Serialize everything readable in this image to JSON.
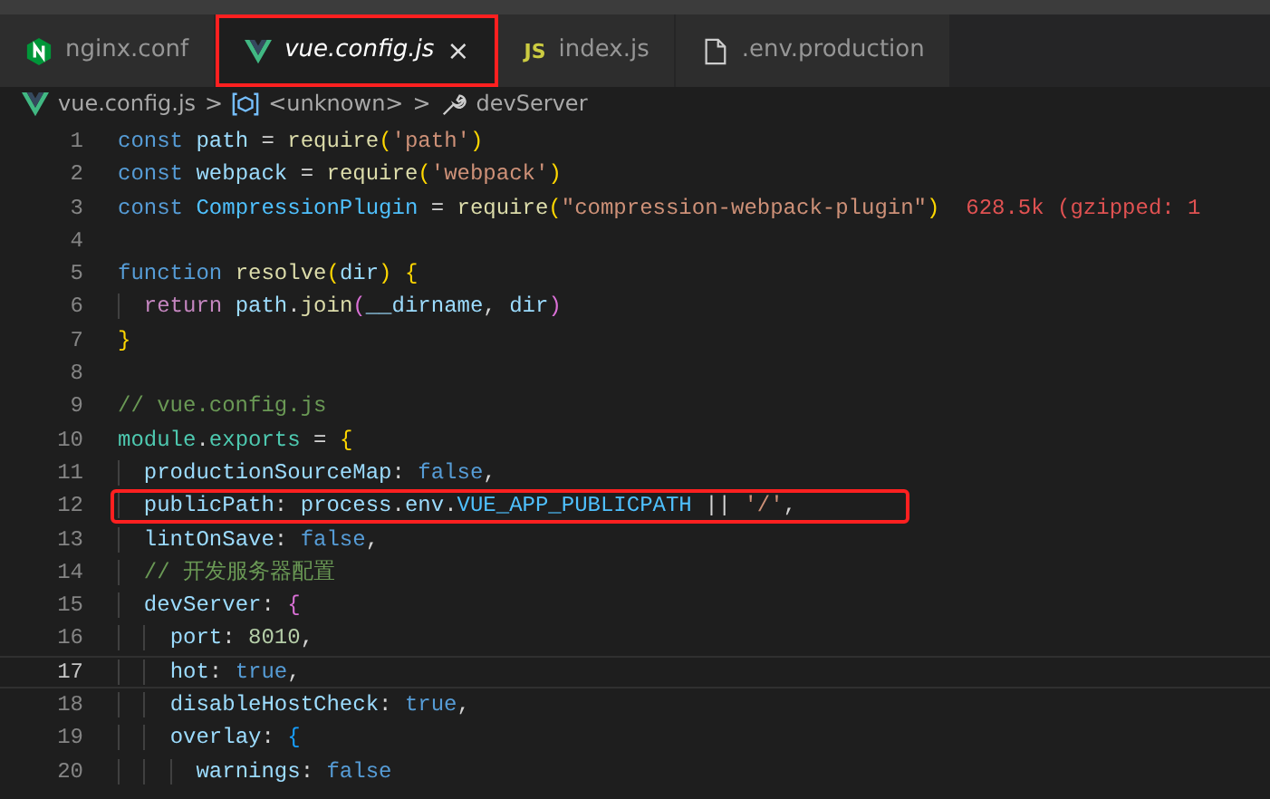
{
  "tabs": [
    {
      "label": "nginx.conf",
      "kind": "nginx",
      "selected": false,
      "italic": false,
      "closable": false,
      "highlighted": false
    },
    {
      "label": "vue.config.js",
      "kind": "vue",
      "selected": true,
      "italic": true,
      "closable": true,
      "highlighted": true
    },
    {
      "label": "index.js",
      "kind": "js",
      "icon_text": "JS",
      "selected": false,
      "italic": false,
      "closable": false,
      "highlighted": false
    },
    {
      "label": ".env.production",
      "kind": "file",
      "selected": false,
      "italic": false,
      "closable": false,
      "highlighted": false
    }
  ],
  "close_glyph": "×",
  "breadcrumb": [
    {
      "kind": "vue",
      "label": "vue.config.js"
    },
    {
      "kind": "module",
      "label": "<unknown>"
    },
    {
      "kind": "wrench",
      "label": "devServer"
    }
  ],
  "breadcrumb_separator": ">",
  "lines": [
    {
      "number": "1",
      "current": false,
      "highlighted": false,
      "tokens": [
        {
          "t": "const ",
          "kind": "kw"
        },
        {
          "t": "path",
          "kind": "var"
        },
        {
          "t": " = ",
          "kind": "punc"
        },
        {
          "t": "require",
          "kind": "fn"
        },
        {
          "t": "(",
          "kind": "b1"
        },
        {
          "t": "'path'",
          "kind": "str"
        },
        {
          "t": ")",
          "kind": "b1"
        }
      ]
    },
    {
      "number": "2",
      "current": false,
      "highlighted": false,
      "tokens": [
        {
          "t": "const ",
          "kind": "kw"
        },
        {
          "t": "webpack",
          "kind": "var"
        },
        {
          "t": " = ",
          "kind": "punc"
        },
        {
          "t": "require",
          "kind": "fn"
        },
        {
          "t": "(",
          "kind": "b1"
        },
        {
          "t": "'webpack'",
          "kind": "str"
        },
        {
          "t": ")",
          "kind": "b1"
        }
      ]
    },
    {
      "number": "3",
      "current": false,
      "highlighted": false,
      "tokens": [
        {
          "t": "const ",
          "kind": "kw"
        },
        {
          "t": "CompressionPlugin",
          "kind": "const"
        },
        {
          "t": " = ",
          "kind": "punc"
        },
        {
          "t": "require",
          "kind": "fn"
        },
        {
          "t": "(",
          "kind": "b1"
        },
        {
          "t": "\"compression-webpack-plugin\"",
          "kind": "str"
        },
        {
          "t": ")",
          "kind": "b1"
        },
        {
          "t": "  628.5k (gzipped: 1",
          "kind": "hint"
        }
      ]
    },
    {
      "number": "4",
      "current": false
    },
    {
      "number": "5",
      "current": false,
      "highlighted": false,
      "tokens": [
        {
          "t": "function ",
          "kind": "kw"
        },
        {
          "t": "resolve",
          "kind": "fn"
        },
        {
          "t": "(",
          "kind": "b1"
        },
        {
          "t": "dir",
          "kind": "var"
        },
        {
          "t": ")",
          "kind": "b1"
        },
        {
          "t": " {",
          "kind": "b1"
        }
      ]
    },
    {
      "number": "6",
      "current": false,
      "highlighted": false,
      "tokens": [
        {
          "t": "  return ",
          "kind": "ctrl"
        },
        {
          "t": "path",
          "kind": "var"
        },
        {
          "t": ".",
          "kind": "punc"
        },
        {
          "t": "join",
          "kind": "fn"
        },
        {
          "t": "(",
          "kind": "b2"
        },
        {
          "t": "__dirname",
          "kind": "var"
        },
        {
          "t": ", ",
          "kind": "punc"
        },
        {
          "t": "dir",
          "kind": "var"
        },
        {
          "t": ")",
          "kind": "b2"
        }
      ]
    },
    {
      "number": "7",
      "current": false,
      "highlighted": false,
      "tokens": [
        {
          "t": "}",
          "kind": "b1"
        }
      ]
    },
    {
      "number": "8",
      "current": false
    },
    {
      "number": "9",
      "current": false,
      "highlighted": false,
      "tokens": [
        {
          "t": "// vue.config.js",
          "kind": "comment"
        }
      ]
    },
    {
      "number": "10",
      "current": false,
      "highlighted": false,
      "tokens": [
        {
          "t": "module",
          "kind": "type"
        },
        {
          "t": ".",
          "kind": "punc"
        },
        {
          "t": "exports",
          "kind": "type"
        },
        {
          "t": " = ",
          "kind": "punc"
        },
        {
          "t": "{",
          "kind": "b1"
        }
      ]
    },
    {
      "number": "11",
      "current": false,
      "highlighted": false,
      "tokens": [
        {
          "t": "  productionSourceMap",
          "kind": "var"
        },
        {
          "t": ": ",
          "kind": "punc"
        },
        {
          "t": "false",
          "kind": "kw"
        },
        {
          "t": ",",
          "kind": "punc"
        }
      ]
    },
    {
      "number": "12",
      "current": false,
      "highlighted": true,
      "tokens": [
        {
          "t": "  publicPath",
          "kind": "var"
        },
        {
          "t": ": ",
          "kind": "punc"
        },
        {
          "t": "process",
          "kind": "var"
        },
        {
          "t": ".",
          "kind": "punc"
        },
        {
          "t": "env",
          "kind": "var"
        },
        {
          "t": ".",
          "kind": "punc"
        },
        {
          "t": "VUE_APP_PUBLICPATH",
          "kind": "const"
        },
        {
          "t": " || ",
          "kind": "punc"
        },
        {
          "t": "'/'",
          "kind": "str"
        },
        {
          "t": ",",
          "kind": "punc"
        }
      ]
    },
    {
      "number": "13",
      "current": false,
      "highlighted": false,
      "tokens": [
        {
          "t": "  lintOnSave",
          "kind": "var"
        },
        {
          "t": ": ",
          "kind": "punc"
        },
        {
          "t": "false",
          "kind": "kw"
        },
        {
          "t": ",",
          "kind": "punc"
        }
      ]
    },
    {
      "number": "14",
      "current": false,
      "highlighted": false,
      "tokens": [
        {
          "t": "  // 开发服务器配置",
          "kind": "comment"
        }
      ]
    },
    {
      "number": "15",
      "current": false,
      "highlighted": false,
      "tokens": [
        {
          "t": "  devServer",
          "kind": "var"
        },
        {
          "t": ": ",
          "kind": "punc"
        },
        {
          "t": "{",
          "kind": "b2"
        }
      ]
    },
    {
      "number": "16",
      "current": false,
      "highlighted": false,
      "tokens": [
        {
          "t": "    port",
          "kind": "var"
        },
        {
          "t": ": ",
          "kind": "punc"
        },
        {
          "t": "8010",
          "kind": "num"
        },
        {
          "t": ",",
          "kind": "punc"
        }
      ]
    },
    {
      "number": "17",
      "current": true,
      "highlighted": false,
      "tokens": [
        {
          "t": "    hot",
          "kind": "var"
        },
        {
          "t": ": ",
          "kind": "punc"
        },
        {
          "t": "true",
          "kind": "kw"
        },
        {
          "t": ",",
          "kind": "punc"
        }
      ]
    },
    {
      "number": "18",
      "current": false,
      "highlighted": false,
      "tokens": [
        {
          "t": "    disableHostCheck",
          "kind": "var"
        },
        {
          "t": ": ",
          "kind": "punc"
        },
        {
          "t": "true",
          "kind": "kw"
        },
        {
          "t": ",",
          "kind": "punc"
        }
      ]
    },
    {
      "number": "19",
      "current": false,
      "highlighted": false,
      "tokens": [
        {
          "t": "    overlay",
          "kind": "var"
        },
        {
          "t": ": ",
          "kind": "punc"
        },
        {
          "t": "{",
          "kind": "b3"
        }
      ]
    },
    {
      "number": "20",
      "current": false,
      "highlighted": false,
      "tokens": [
        {
          "t": "      warnings",
          "kind": "var"
        },
        {
          "t": ": ",
          "kind": "punc"
        },
        {
          "t": "false",
          "kind": "kw"
        }
      ]
    }
  ]
}
